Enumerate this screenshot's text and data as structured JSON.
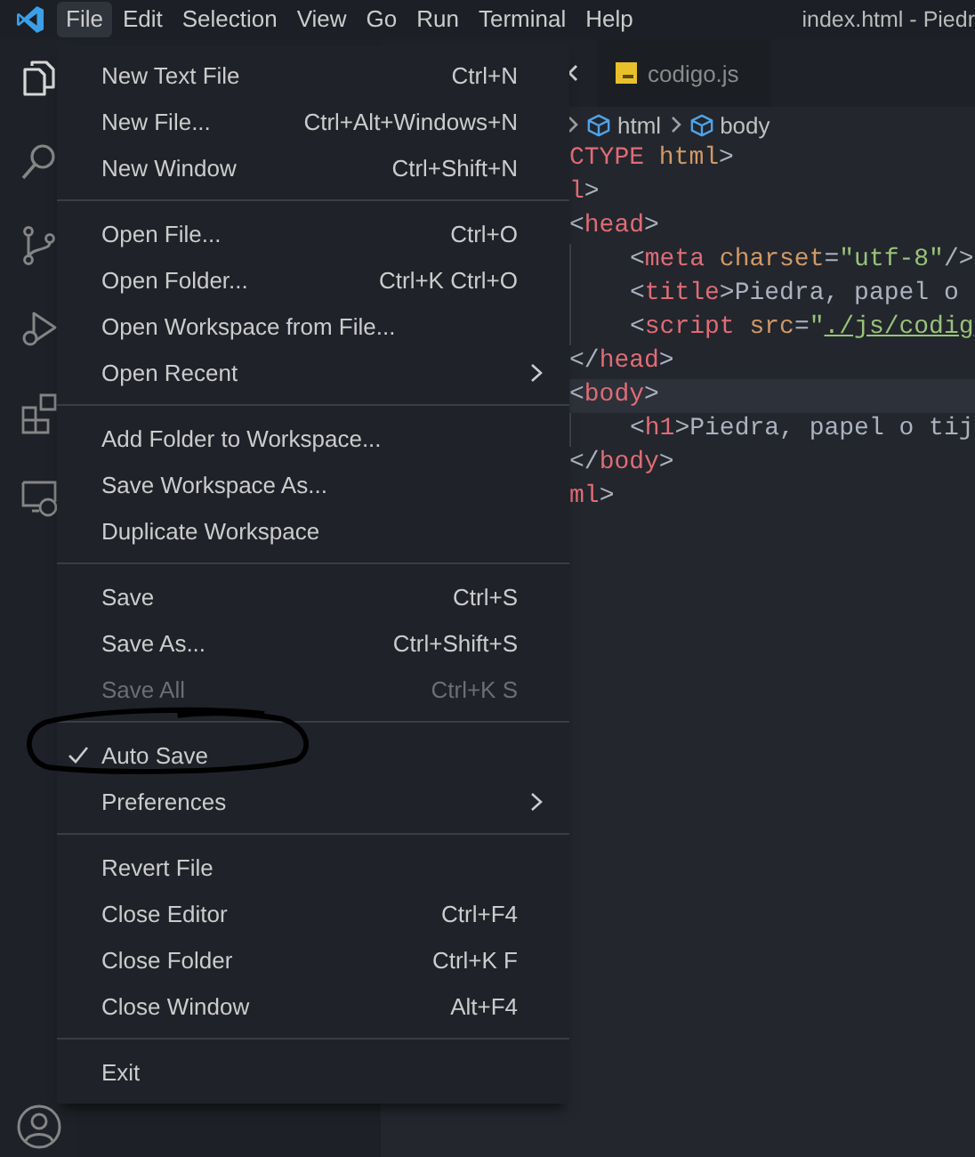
{
  "title_bar": {
    "menus": [
      {
        "label": "File",
        "selected": true
      },
      {
        "label": "Edit",
        "selected": false
      },
      {
        "label": "Selection",
        "selected": false
      },
      {
        "label": "View",
        "selected": false
      },
      {
        "label": "Go",
        "selected": false
      },
      {
        "label": "Run",
        "selected": false
      },
      {
        "label": "Terminal",
        "selected": false
      },
      {
        "label": "Help",
        "selected": false
      }
    ],
    "title": "index.html - Piedr"
  },
  "activity_bar": [
    {
      "kind": "files",
      "selected": true
    },
    {
      "kind": "search",
      "selected": false
    },
    {
      "kind": "source-control",
      "selected": false
    },
    {
      "kind": "run",
      "selected": false
    },
    {
      "kind": "extensions",
      "selected": false
    },
    {
      "kind": "remote",
      "selected": false
    }
  ],
  "tabs": [
    {
      "label": "codigo.js",
      "selected": false
    }
  ],
  "breadcrumbs": [
    "html",
    "body"
  ],
  "code_lines": [
    {
      "indented": false,
      "current": false,
      "tokens": [
        {
          "kind": "tag",
          "text": "CTYPE"
        },
        {
          "kind": "attr",
          "text": " html"
        },
        {
          "kind": "punct",
          "text": ">"
        }
      ]
    },
    {
      "indented": false,
      "current": false,
      "tokens": [
        {
          "kind": "tag",
          "text": "l"
        },
        {
          "kind": "punct",
          "text": ">"
        }
      ]
    },
    {
      "indented": false,
      "current": false,
      "tokens": [
        {
          "kind": "punct",
          "text": "<"
        },
        {
          "kind": "tag",
          "text": "head"
        },
        {
          "kind": "punct",
          "text": ">"
        }
      ]
    },
    {
      "indented": true,
      "current": false,
      "tokens": [
        {
          "kind": "punct",
          "text": "<"
        },
        {
          "kind": "tag",
          "text": "meta"
        },
        {
          "kind": "attr",
          "text": " charset"
        },
        {
          "kind": "punct",
          "text": "="
        },
        {
          "kind": "string",
          "text": "\"utf-8\""
        },
        {
          "kind": "punct",
          "text": "/>"
        }
      ]
    },
    {
      "indented": true,
      "current": false,
      "tokens": [
        {
          "kind": "punct",
          "text": "<"
        },
        {
          "kind": "tag",
          "text": "title"
        },
        {
          "kind": "punct",
          "text": ">"
        },
        {
          "kind": "text",
          "text": "Piedra, papel o"
        }
      ]
    },
    {
      "indented": true,
      "current": false,
      "tokens": [
        {
          "kind": "punct",
          "text": "<"
        },
        {
          "kind": "tag",
          "text": "script"
        },
        {
          "kind": "attr",
          "text": " src"
        },
        {
          "kind": "punct",
          "text": "="
        },
        {
          "kind": "string",
          "text": "\""
        },
        {
          "kind": "link",
          "text": "./js/codig"
        }
      ]
    },
    {
      "indented": false,
      "current": false,
      "tokens": [
        {
          "kind": "punct",
          "text": "</"
        },
        {
          "kind": "tag",
          "text": "head"
        },
        {
          "kind": "punct",
          "text": ">"
        }
      ]
    },
    {
      "indented": false,
      "current": true,
      "tokens": [
        {
          "kind": "punct",
          "text": "<"
        },
        {
          "kind": "tag",
          "text": "body"
        },
        {
          "kind": "punct",
          "text": ">"
        }
      ]
    },
    {
      "indented": true,
      "current": false,
      "tokens": [
        {
          "kind": "punct",
          "text": "<"
        },
        {
          "kind": "tag",
          "text": "h1"
        },
        {
          "kind": "punct",
          "text": ">"
        },
        {
          "kind": "text",
          "text": "Piedra, papel o tij"
        }
      ]
    },
    {
      "indented": false,
      "current": false,
      "tokens": [
        {
          "kind": "punct",
          "text": "</"
        },
        {
          "kind": "tag",
          "text": "body"
        },
        {
          "kind": "punct",
          "text": ">"
        }
      ]
    },
    {
      "indented": false,
      "current": false,
      "tokens": [
        {
          "kind": "tag",
          "text": "ml"
        },
        {
          "kind": "punct",
          "text": ">"
        }
      ]
    }
  ],
  "file_menu": [
    [
      {
        "label": "New Text File",
        "shortcut": "Ctrl+N",
        "checked": false,
        "disabled": false,
        "submenu": false
      },
      {
        "label": "New File...",
        "shortcut": "Ctrl+Alt+Windows+N",
        "checked": false,
        "disabled": false,
        "submenu": false
      },
      {
        "label": "New Window",
        "shortcut": "Ctrl+Shift+N",
        "checked": false,
        "disabled": false,
        "submenu": false
      }
    ],
    [
      {
        "label": "Open File...",
        "shortcut": "Ctrl+O",
        "checked": false,
        "disabled": false,
        "submenu": false
      },
      {
        "label": "Open Folder...",
        "shortcut": "Ctrl+K Ctrl+O",
        "checked": false,
        "disabled": false,
        "submenu": false
      },
      {
        "label": "Open Workspace from File...",
        "checked": false,
        "disabled": false,
        "submenu": false
      },
      {
        "label": "Open Recent",
        "checked": false,
        "disabled": false,
        "submenu": true
      }
    ],
    [
      {
        "label": "Add Folder to Workspace...",
        "checked": false,
        "disabled": false,
        "submenu": false
      },
      {
        "label": "Save Workspace As...",
        "checked": false,
        "disabled": false,
        "submenu": false
      },
      {
        "label": "Duplicate Workspace",
        "checked": false,
        "disabled": false,
        "submenu": false
      }
    ],
    [
      {
        "label": "Save",
        "shortcut": "Ctrl+S",
        "checked": false,
        "disabled": false,
        "submenu": false
      },
      {
        "label": "Save As...",
        "shortcut": "Ctrl+Shift+S",
        "checked": false,
        "disabled": false,
        "submenu": false
      },
      {
        "label": "Save All",
        "shortcut": "Ctrl+K S",
        "checked": false,
        "disabled": true,
        "submenu": false
      }
    ],
    [
      {
        "label": "Auto Save",
        "checked": true,
        "disabled": false,
        "submenu": false
      },
      {
        "label": "Preferences",
        "checked": false,
        "disabled": false,
        "submenu": true
      }
    ],
    [
      {
        "label": "Revert File",
        "checked": false,
        "disabled": false,
        "submenu": false
      },
      {
        "label": "Close Editor",
        "shortcut": "Ctrl+F4",
        "checked": false,
        "disabled": false,
        "submenu": false
      },
      {
        "label": "Close Folder",
        "shortcut": "Ctrl+K F",
        "checked": false,
        "disabled": false,
        "submenu": false
      },
      {
        "label": "Close Window",
        "shortcut": "Alt+F4",
        "checked": false,
        "disabled": false,
        "submenu": false
      }
    ],
    [
      {
        "label": "Exit",
        "checked": false,
        "disabled": false,
        "submenu": false
      }
    ]
  ]
}
